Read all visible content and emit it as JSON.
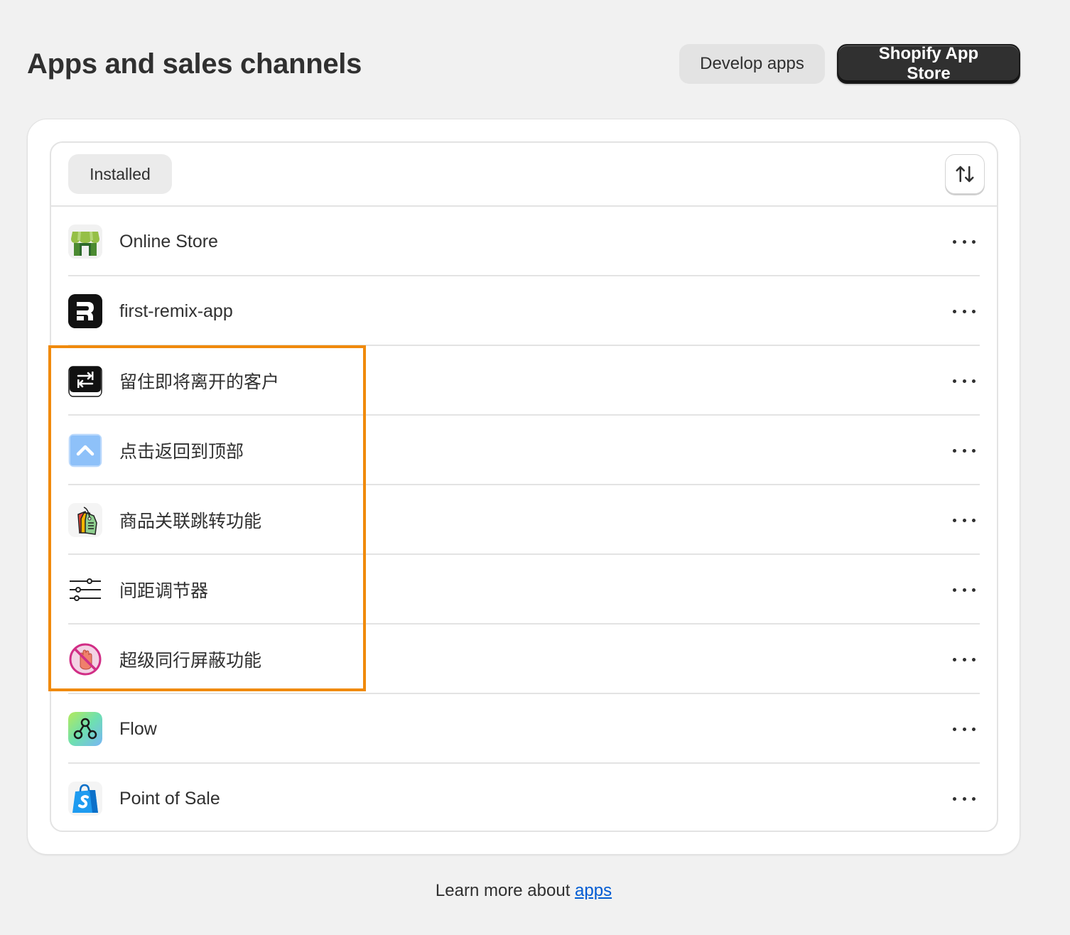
{
  "page": {
    "title": "Apps and sales channels",
    "develop_apps_label": "Develop apps",
    "app_store_label": "Shopify App Store"
  },
  "list": {
    "tab_label": "Installed",
    "sort_icon": "sort-arrows-icon",
    "apps": [
      {
        "name": "Online Store",
        "icon": "online-store-icon"
      },
      {
        "name": "first-remix-app",
        "icon": "remix-icon"
      },
      {
        "name": "留住即将离开的客户",
        "icon": "exit-intent-icon"
      },
      {
        "name": "点击返回到顶部",
        "icon": "back-to-top-icon"
      },
      {
        "name": "商品关联跳转功能",
        "icon": "product-tag-icon"
      },
      {
        "name": "间距调节器",
        "icon": "sliders-icon"
      },
      {
        "name": "超级同行屏蔽功能",
        "icon": "block-hand-icon"
      },
      {
        "name": "Flow",
        "icon": "flow-icon"
      },
      {
        "name": "Point of Sale",
        "icon": "shopify-bag-icon"
      }
    ]
  },
  "footer": {
    "prefix": "Learn more about",
    "link_label": "apps"
  },
  "colors": {
    "highlight": "#f08a0c",
    "link": "#005bd3",
    "primary_button": "#303030"
  }
}
